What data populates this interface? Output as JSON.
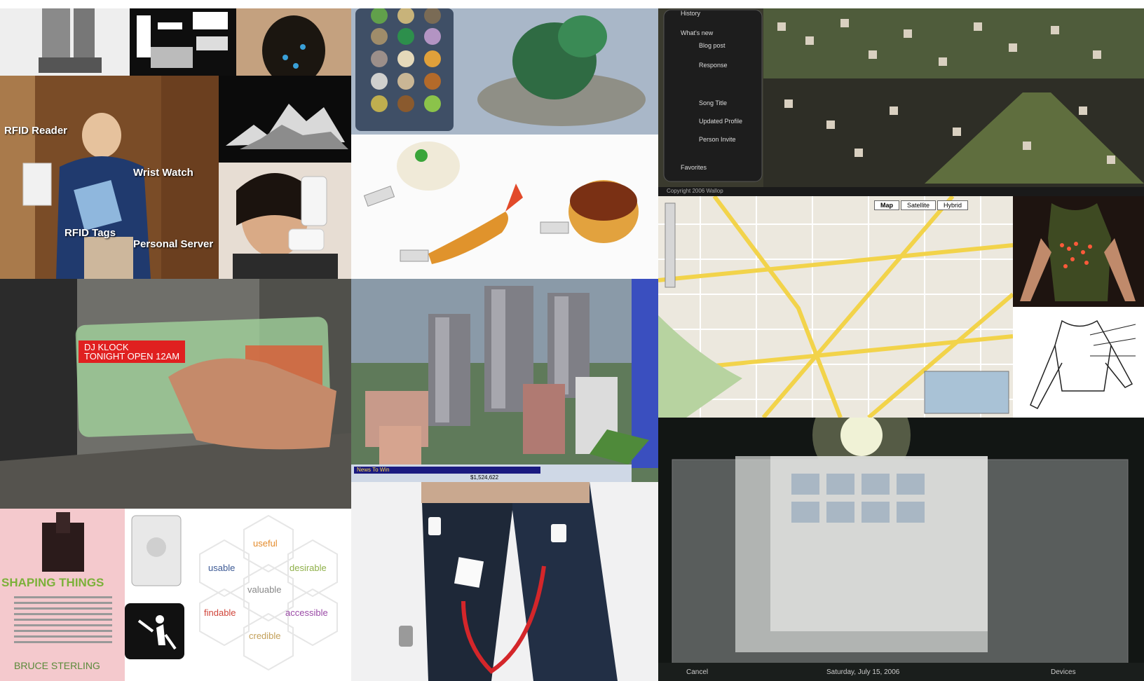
{
  "frame_color": "#2a80b9",
  "rfid": {
    "labels": [
      "RFID Reader",
      "Wrist Watch",
      "RFID Tags",
      "Personal Server"
    ]
  },
  "dj": {
    "line1": "DJ KLOCK",
    "line2": "TONIGHT OPEN 12AM"
  },
  "book": {
    "title": "SHAPING THINGS",
    "author": "BRUCE STERLING"
  },
  "honeycomb": {
    "words": [
      "useful",
      "usable",
      "desirable",
      "valuable",
      "findable",
      "accessible",
      "credible"
    ]
  },
  "wallop": {
    "sections": [
      "History",
      "What's new",
      "Favorites"
    ],
    "feed": [
      "Blog post",
      "Response",
      "Song Title",
      "Updated Profile",
      "Person Invite"
    ],
    "copyright": "Copyright 2006 Wallop"
  },
  "map": {
    "buttons": [
      "Map",
      "Satellite",
      "Hybrid"
    ]
  },
  "simcity": {
    "news_ticker": "News To Win",
    "funds": "$1,524,622"
  },
  "desktop": {
    "date": "Saturday, July 15, 2006",
    "left": "Cancel",
    "right1": "Devices"
  }
}
